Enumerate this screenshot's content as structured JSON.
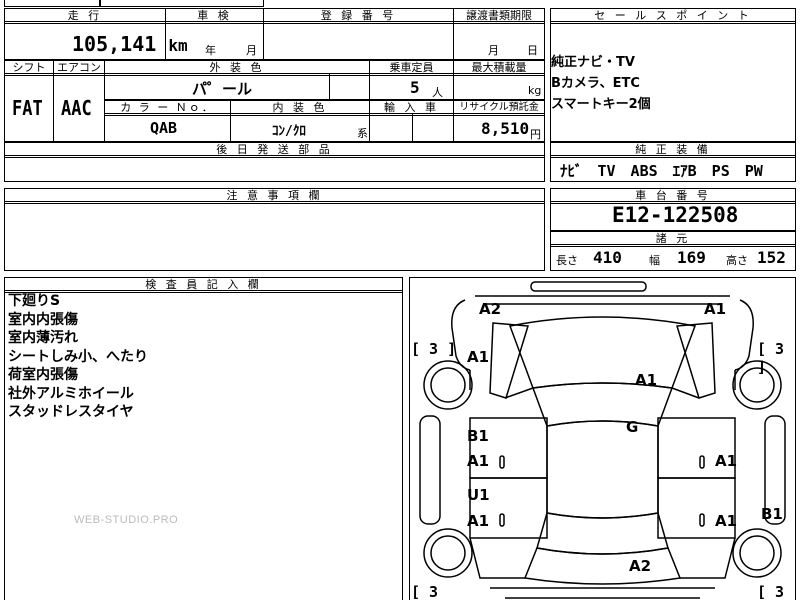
{
  "top_left_partial": "",
  "labels": {
    "mileage": "走 行",
    "inspection": "車 検",
    "registration": "登 録 番 号",
    "transfer_deadline": "譲渡書類期限",
    "sales_points": "セ ー ル ス ポ イ ン ト",
    "shift": "シフト",
    "aircon": "エアコン",
    "exterior_color": "外 装 色",
    "capacity": "乗車定員",
    "max_load": "最大積載量",
    "color_no": "カ ラ ー Ｎｏ．",
    "interior_color": "内 装 色",
    "import": "輸 入 車",
    "recycle": "リサイクル預託金",
    "later_parts": "後 日 発 送 部 品",
    "genuine_equipment": "純 正 装 備",
    "notes": "注 意 事 項 欄",
    "chassis_no": "車 台 番 号",
    "specs": "諸 元",
    "inspector": "検 査 員 記 入 欄"
  },
  "values": {
    "mileage": "105,141",
    "mileage_unit": "km",
    "inspection_year": "年",
    "inspection_month": "月",
    "transfer_month": "月",
    "transfer_day": "日",
    "shift": "FAT",
    "aircon": "AAC",
    "exterior_color": "パ゜ール",
    "capacity": "5",
    "capacity_unit": "人",
    "max_load_unit": "kg",
    "color_no": "QAB",
    "interior_color": "ｺﾝ/ｸﾛ",
    "interior_suffix": "系",
    "recycle": "8,510",
    "recycle_unit": "円",
    "genuine_equipment": "ﾅﾋﾞ　TV　ABS　ｴｱB　PS　PW",
    "chassis_no": "E12-122508",
    "length_label": "長さ",
    "length": "410",
    "width_label": "幅",
    "width": "169",
    "height_label": "高さ",
    "height": "152"
  },
  "sales_points": [
    "純正ナビ・TV",
    "Bカメラ、ETC",
    "スマートキー2個"
  ],
  "inspector_notes": [
    "下廻りS",
    "室内内張傷",
    "室内薄汚れ",
    "シートしみ小、へたり",
    "荷室内張傷",
    "社外アルミホイール",
    "スタッドレスタイヤ"
  ],
  "watermark": "WEB-STUDIO.PRO",
  "diagram": {
    "marks": [
      "A2",
      "A1",
      "A1",
      "A1",
      "G",
      "B1",
      "A1",
      "A1",
      "U1",
      "A1",
      "A1",
      "B1",
      "A2"
    ],
    "brackets": [
      "[ 3 ]",
      "[ 3 ]",
      "[ 3",
      "[ 3 ]"
    ]
  }
}
